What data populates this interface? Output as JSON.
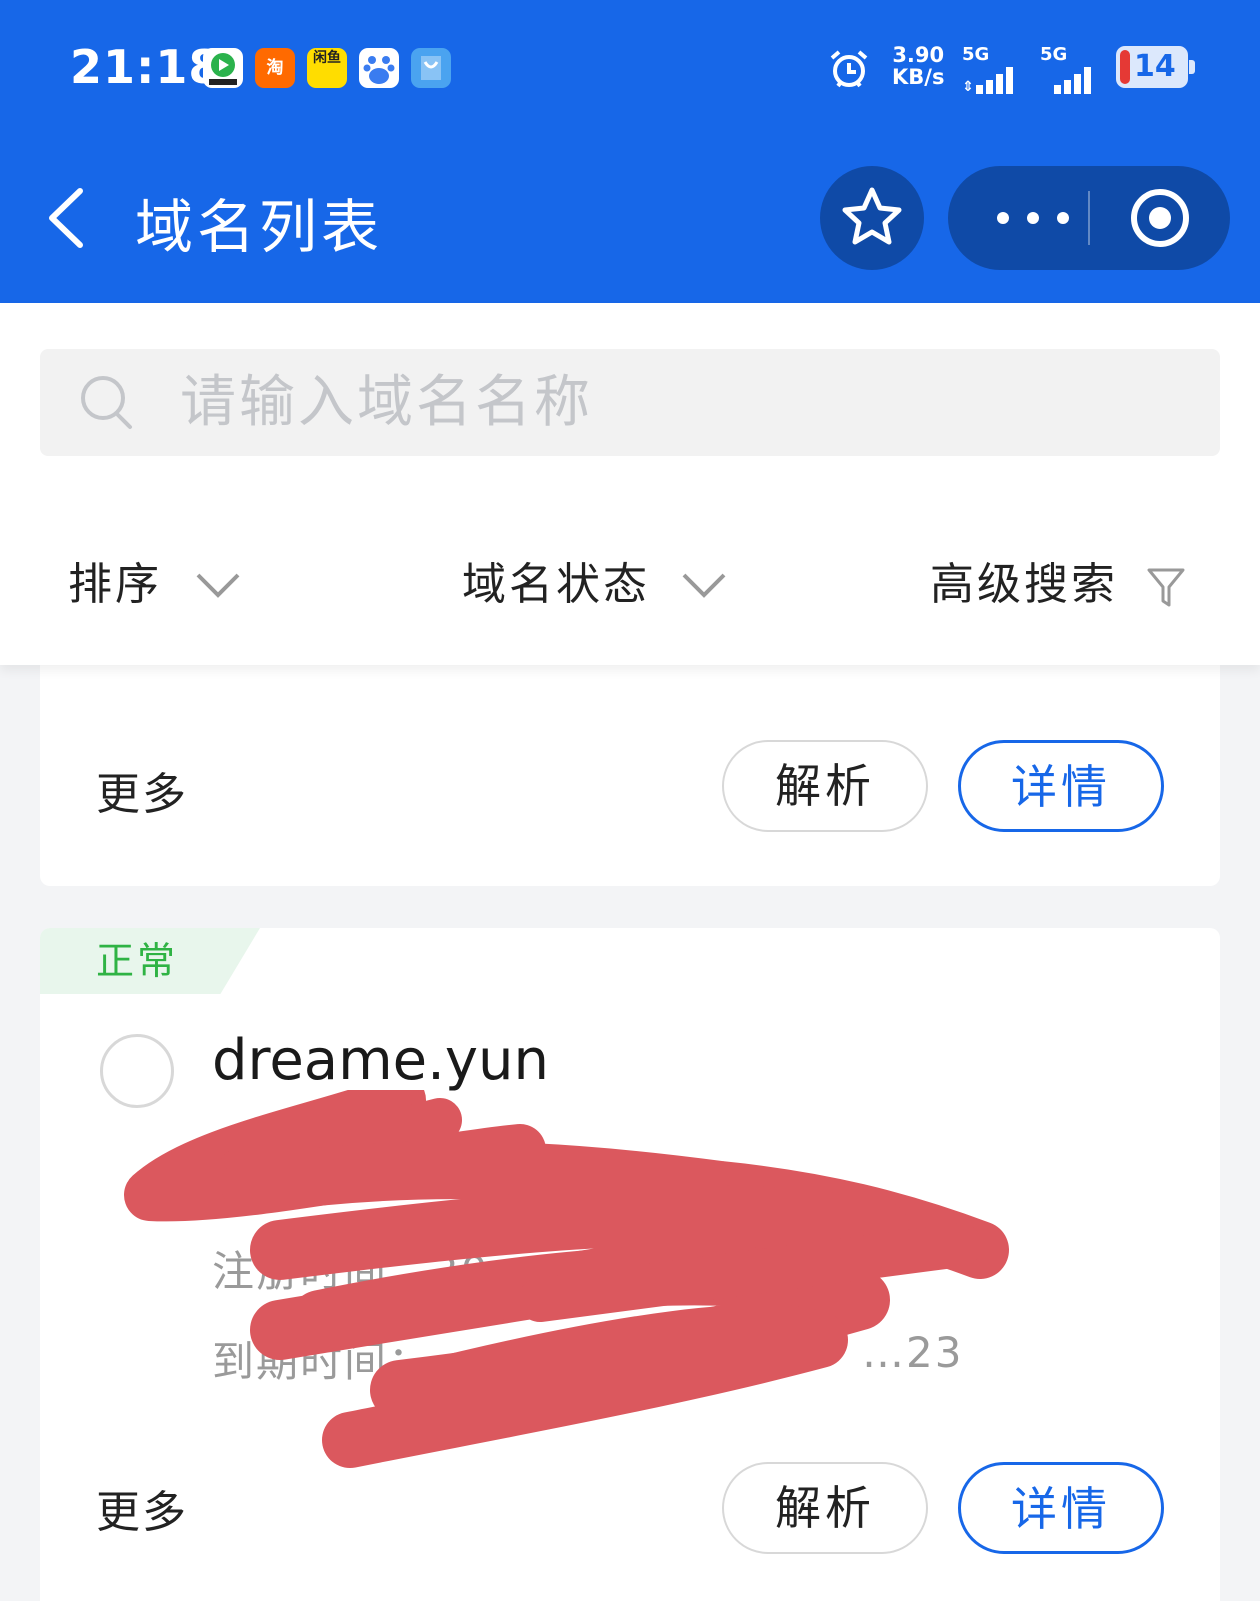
{
  "status_bar": {
    "time": "21:18",
    "app_icons": [
      {
        "icon": "video-app-icon",
        "color": "#2bb24c",
        "label": ""
      },
      {
        "icon": "taobao-icon",
        "color": "#ff6a00",
        "label": "淘"
      },
      {
        "icon": "xianyu-icon",
        "color": "#ffdd00",
        "label": "闲鱼"
      },
      {
        "icon": "baidu-icon",
        "color": "#3a7cf0",
        "label": "du"
      },
      {
        "icon": "shopping-bag-icon",
        "color": "#4aa3f0",
        "label": ""
      }
    ],
    "net_speed_value": "3.90",
    "net_speed_unit": "KB/s",
    "signal_1": "5G",
    "signal_2": "5G",
    "battery": "14"
  },
  "header": {
    "title": "域名列表",
    "bg_color": "#1767e8"
  },
  "search": {
    "placeholder": "请输入域名名称"
  },
  "filters": {
    "sort": "排序",
    "status": "域名状态",
    "advanced": "高级搜索"
  },
  "cards": [
    {
      "more": "更多",
      "resolve_label": "解析",
      "detail_label": "详情"
    },
    {
      "status": "正常",
      "domain": "dreame.yun",
      "register_label": "注册时间：",
      "register_value": "20",
      "expire_label": "到期时间：",
      "expire_value": "…23",
      "more": "更多",
      "resolve_label": "解析",
      "detail_label": "详情"
    }
  ],
  "colors": {
    "primary": "#1767e8",
    "status_green": "#2fb344",
    "status_bg": "#e8f6ec",
    "redaction": "#db585e"
  }
}
